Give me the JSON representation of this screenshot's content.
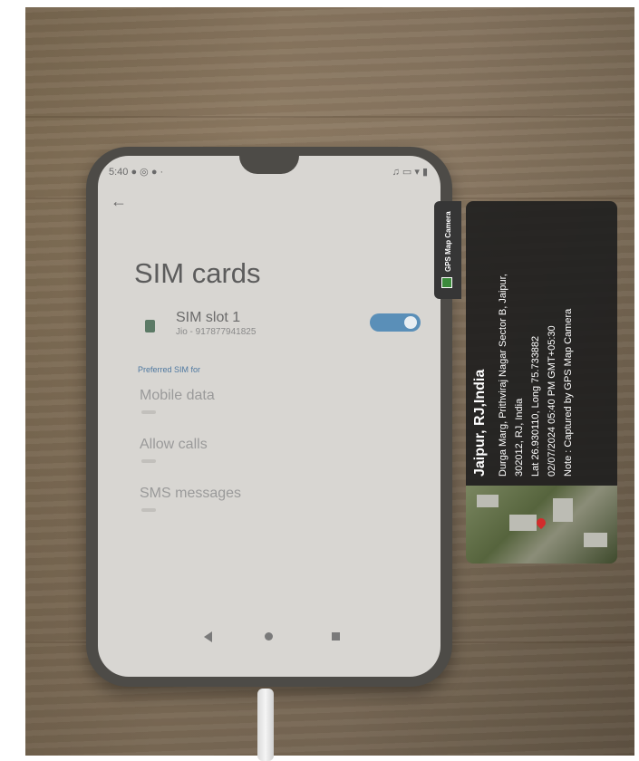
{
  "phone_screen": {
    "status_time": "5:40",
    "status_icons_left": "● ◎ ● ·",
    "status_icons_right": "♫ ▭ ▾ ▮",
    "title": "SIM cards",
    "sim": {
      "label": "SIM slot 1",
      "number": "Jio - 917877941825",
      "enabled": true
    },
    "preferred_label": "Preferred SIM for",
    "settings": [
      "Mobile data",
      "Allow calls",
      "SMS messages"
    ]
  },
  "overlay": {
    "app_label": "GPS Map Camera",
    "city": "Jaipur, RJ,India",
    "address_line1": "Durga Marg, Prithviraj Nagar Sector B, Jaipur,",
    "address_line2": "302012, RJ, India",
    "coordinates": "Lat 26.930110, Long 75.733882",
    "datetime": "02/07/2024 05:40 PM GMT+05:30",
    "note": "Note : Captured by GPS Map Camera"
  },
  "colors": {
    "toggle": "#5a8fb8",
    "accent_link": "#4e78a0",
    "map_pin": "#d22c2c"
  }
}
